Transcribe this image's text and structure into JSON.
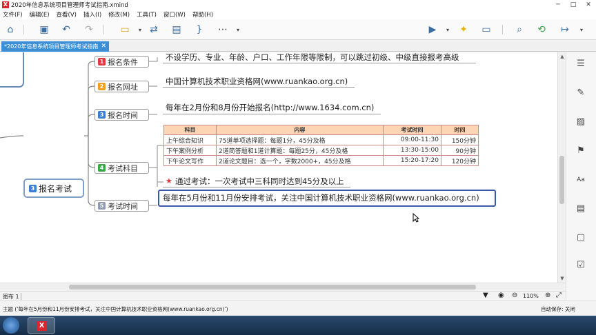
{
  "window": {
    "title": "2020年信息系统项目管理师考试指南.xmind",
    "app_icon_glyph": "X"
  },
  "menu": [
    "文件(F)",
    "编辑(E)",
    "查看(V)",
    "插入(I)",
    "修改(M)",
    "工具(T)",
    "窗口(W)",
    "帮助(H)"
  ],
  "tab": {
    "label": "*2020年信息系统项目管理师考试指南",
    "close": "✕"
  },
  "mindmap": {
    "root": {
      "num": "3",
      "label": "报名考试"
    },
    "branches": [
      {
        "num": "1",
        "label": "报名条件",
        "leaf": "不设学历、专业、年龄、户口、工作年限等限制，可以跳过初级、中级直接报考高级"
      },
      {
        "num": "2",
        "label": "报名网址",
        "leaf": "中国计算机技术职业资格网(www.ruankao.org.cn)"
      },
      {
        "num": "3",
        "label": "报名时间",
        "leaf": "每年在2月份和8月份开始报名(http://www.1634.com.cn)"
      },
      {
        "num": "4",
        "label": "考试科目",
        "leaf": "通过考试：一次考试中三科同时达到45分及以上"
      },
      {
        "num": "5",
        "label": "考试时间",
        "leaf": "每年在5月份和11月份安排考试，关注中国计算机技术职业资格网(www.ruankao.org.cn)"
      }
    ],
    "table": {
      "headers": [
        "科目",
        "内容",
        "考试时间",
        "时间"
      ],
      "rows": [
        [
          "上午综合知识",
          "75道单项选择题：每题1分，45分及格",
          "09:00-11:30",
          "150分钟"
        ],
        [
          "下午案例分析",
          "2道简答题和1道计算题：每题25分，45分及格",
          "13:30-15:00",
          "90分钟"
        ],
        [
          "下午论文写作",
          "2道论文题目：选一个，字数2000+，45分及格",
          "15:20-17:20",
          "120分钟"
        ]
      ]
    }
  },
  "status": {
    "sheet": "图布 1",
    "zoom": "110%",
    "topic": "主题 ('每年在5月份和11月份安排考试，关注中国计算机技术职业资格网(www.ruankao.org.cn)')",
    "autosave": "自动保存: 关闭"
  },
  "colors": {
    "accent": "#3b8fd6",
    "highlight_border": "#3a58a8"
  }
}
